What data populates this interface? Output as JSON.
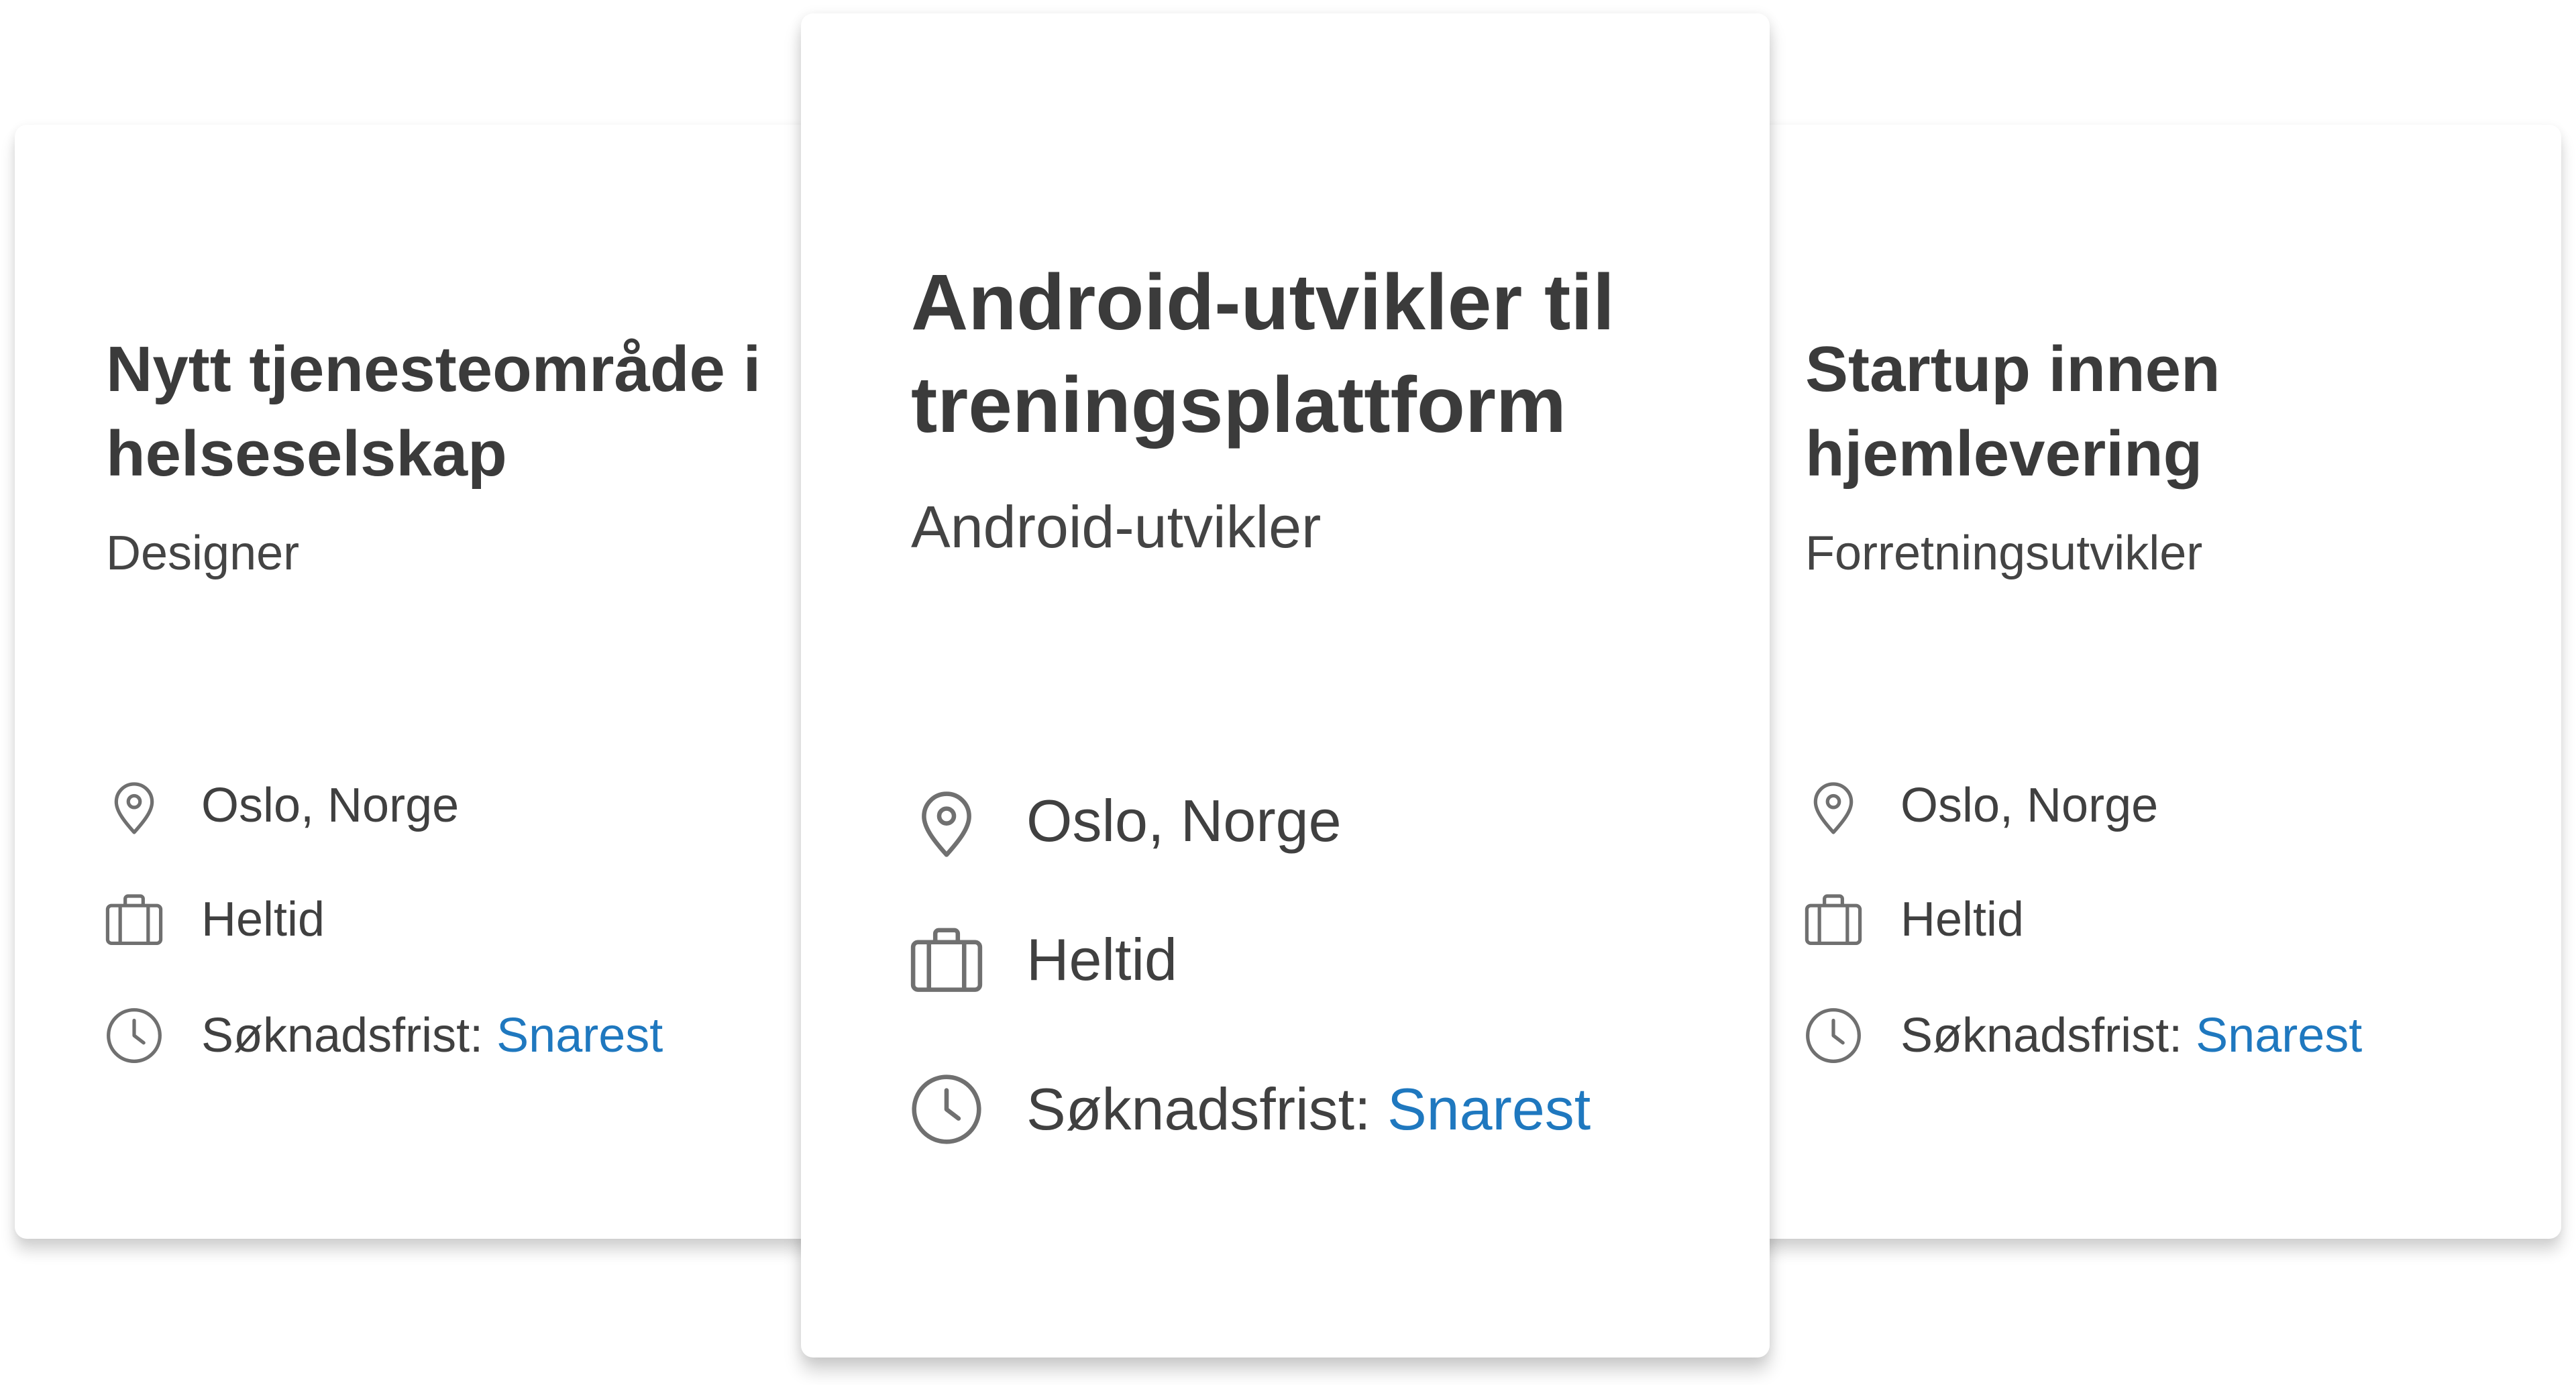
{
  "colors": {
    "text": "#3b3b3b",
    "icon": "#707070",
    "link": "#1f78bf",
    "card_background": "#ffffff"
  },
  "cards": [
    {
      "title": "Nytt tjenesteområde i helseselskap",
      "role": "Designer",
      "location": "Oslo, Norge",
      "employment_type": "Heltid",
      "deadline_label": "Søknadsfrist:",
      "deadline_value": "Snarest"
    },
    {
      "title": "Android-utvikler til treningsplattform",
      "role": "Android-utvikler",
      "location": "Oslo, Norge",
      "employment_type": "Heltid",
      "deadline_label": "Søknadsfrist:",
      "deadline_value": "Snarest"
    },
    {
      "title": "Startup innen hjemlevering",
      "role": "Forretningsutvikler",
      "location": "Oslo, Norge",
      "employment_type": "Heltid",
      "deadline_label": "Søknadsfrist:",
      "deadline_value": "Snarest"
    }
  ],
  "icons": {
    "location": "map-pin-icon",
    "employment_type": "briefcase-icon",
    "deadline": "clock-icon"
  }
}
